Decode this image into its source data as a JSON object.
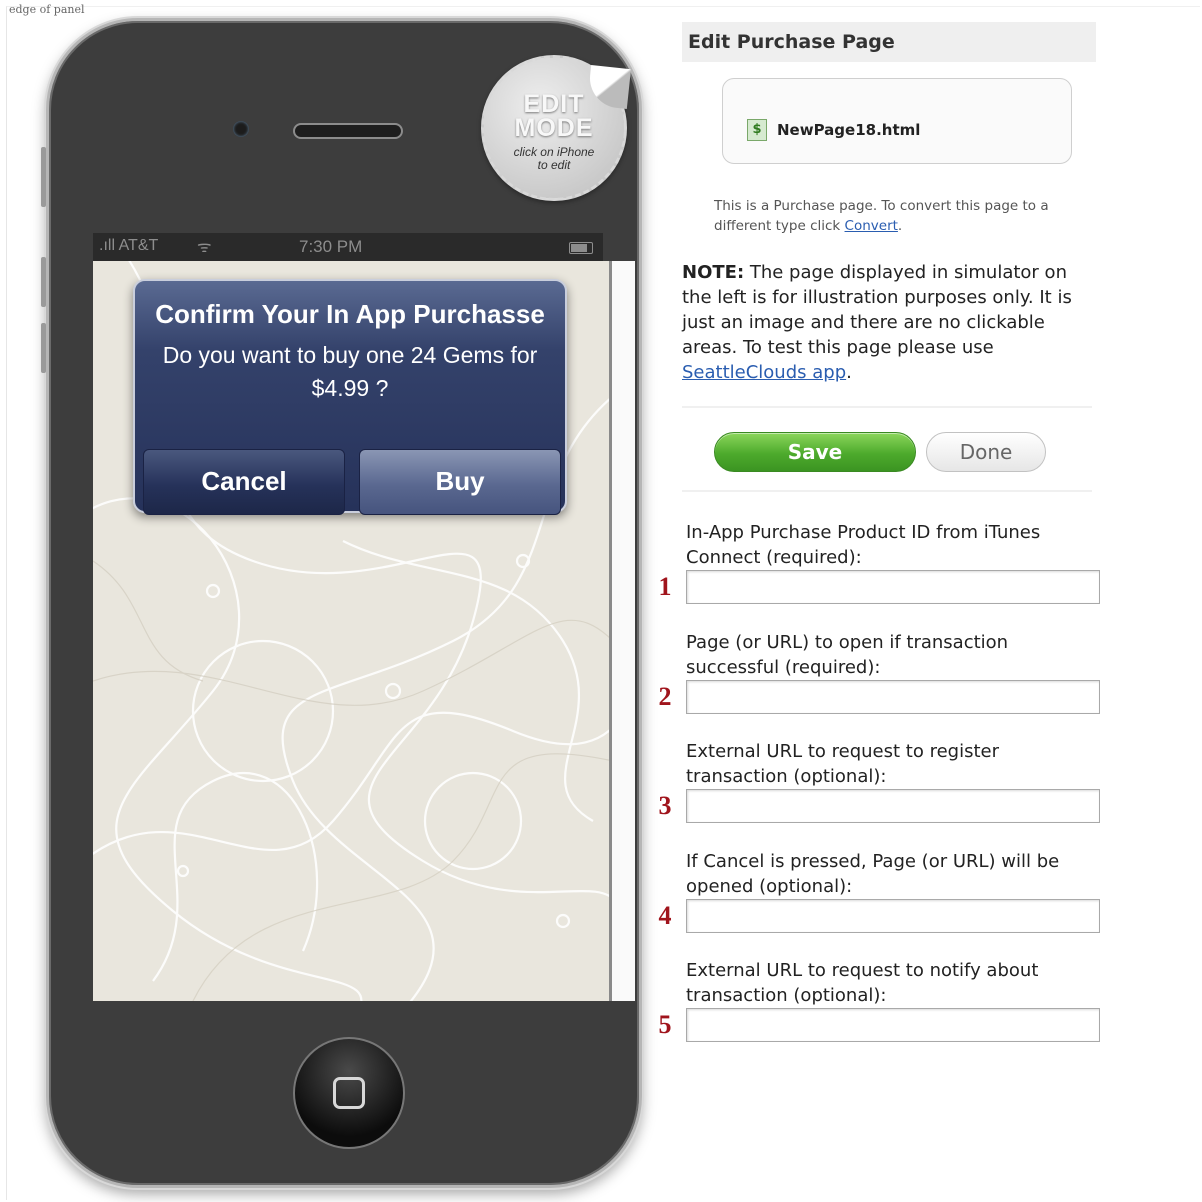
{
  "page": {
    "top_caption": "edge of panel"
  },
  "phone": {
    "status": {
      "carrier": ".ıll AT&T",
      "wifi": "ᯤ",
      "time": "7:30 PM"
    },
    "badge": {
      "line1": "EDIT",
      "line2": "MODE",
      "line3": "click on iPhone",
      "line4": "to edit"
    },
    "alert": {
      "title": "Confirm Your In App Purchasse",
      "message": "Do you want to buy one 24 Gems for $4.99 ?",
      "cancel_label": "Cancel",
      "buy_label": "Buy"
    }
  },
  "panel": {
    "title": "Edit Purchase Page",
    "file": {
      "icon": "dollar-page-icon",
      "icon_glyph": "$",
      "name": "NewPage18.html"
    },
    "info": {
      "text": "This is a Purchase page. To convert this page to a different type click ",
      "link": "Convert",
      "end": "."
    },
    "note": {
      "prefix": "NOTE:",
      "text": " The page displayed in simulator on the left is for illustration purposes only. It is just an image and there are no clickable areas. To test this page please use ",
      "link": "SeattleClouds app",
      "end": "."
    },
    "save_label": "Save",
    "done_label": "Done",
    "fields": [
      {
        "num": "1",
        "label": "In-App Purchase Product ID from iTunes Connect (required):",
        "value": ""
      },
      {
        "num": "2",
        "label": "Page (or URL) to open if transaction successful (required):",
        "value": ""
      },
      {
        "num": "3",
        "label": "External URL to request to register transaction (optional):",
        "value": ""
      },
      {
        "num": "4",
        "label": "If Cancel is pressed, Page (or URL) will be opened (optional):",
        "value": ""
      },
      {
        "num": "5",
        "label": "External URL to request to notify about transaction (optional):",
        "value": ""
      }
    ]
  },
  "colors": {
    "save_green": "#4daa2c",
    "number_red": "#a0141c",
    "alert_navy": "#26325a",
    "link_blue": "#2a5db0"
  }
}
